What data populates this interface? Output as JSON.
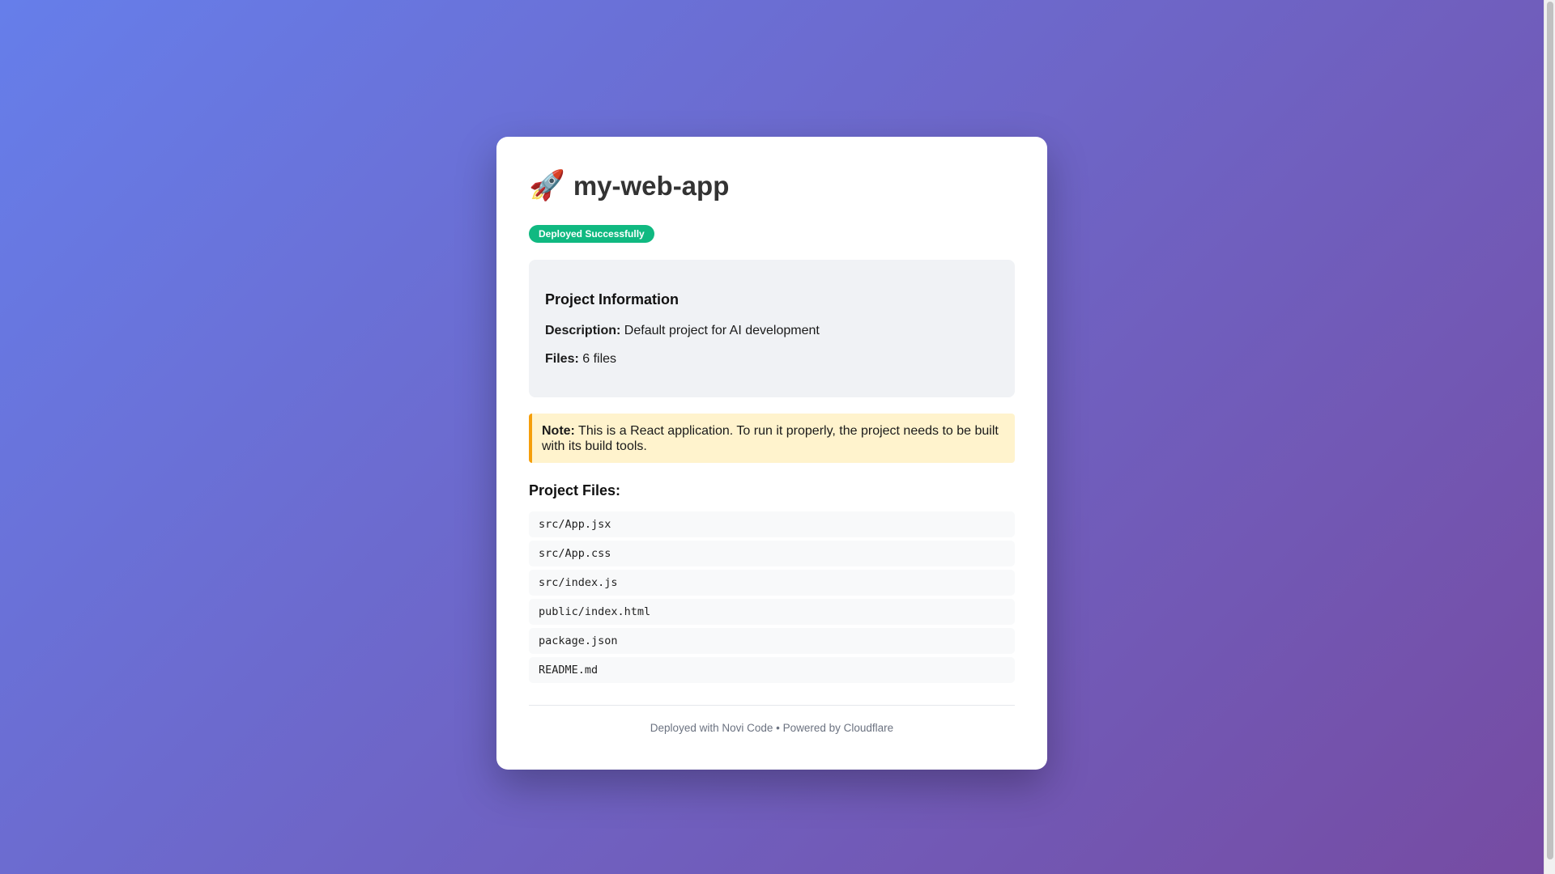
{
  "project": {
    "icon": "rocket-icon",
    "icon_glyph": "🚀",
    "title": "my-web-app",
    "status": "Deployed Successfully"
  },
  "info": {
    "heading": "Project Information",
    "description_label": "Description:",
    "description_value": "Default project for AI development",
    "files_label": "Files:",
    "files_value": "6 files"
  },
  "note": {
    "label": "Note:",
    "text": "This is a React application. To run it properly, the project needs to be built with its build tools."
  },
  "files": {
    "heading": "Project Files:",
    "items": [
      "src/App.jsx",
      "src/App.css",
      "src/index.js",
      "public/index.html",
      "package.json",
      "README.md"
    ]
  },
  "footer": {
    "text": "Deployed with Novi Code • Powered by Cloudflare"
  },
  "colors": {
    "background_start": "#667eea",
    "background_end": "#764ba2",
    "status_badge": "#10b981",
    "note_background": "#fff3cd",
    "note_border": "#f59e0b"
  }
}
